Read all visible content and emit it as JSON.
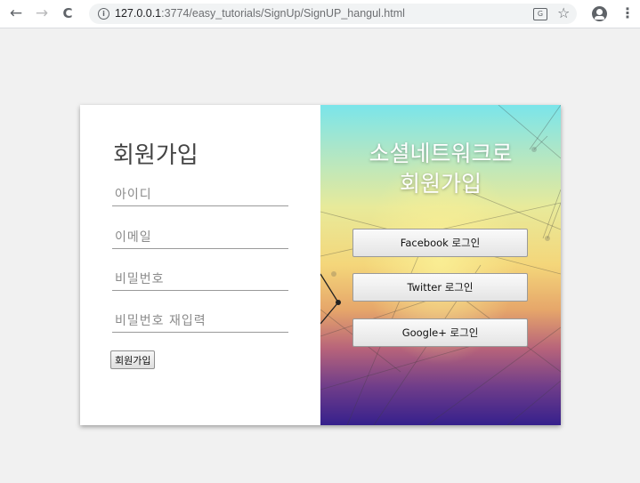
{
  "browser": {
    "url_host": "127.0.0.1",
    "url_rest": ":3774/easy_tutorials/SignUp/SignUP_hangul.html",
    "back_glyph": "←",
    "forward_glyph": "→",
    "reload_glyph": "C",
    "info_glyph": "i",
    "translate_glyph": "G",
    "star_glyph": "☆",
    "menu_glyph": "⋮"
  },
  "signup": {
    "title": "회원가입",
    "id_placeholder": "아이디",
    "email_placeholder": "이메일",
    "password_placeholder": "비밀번호",
    "password_confirm_placeholder": "비밀번호 재입력",
    "submit_label": "회원가입"
  },
  "social": {
    "title_line1": "소셜네트워크로",
    "title_line2": "회원가입",
    "facebook_label": "Facebook 로그인",
    "twitter_label": "Twitter 로그인",
    "google_label": "Google+ 로그인"
  }
}
